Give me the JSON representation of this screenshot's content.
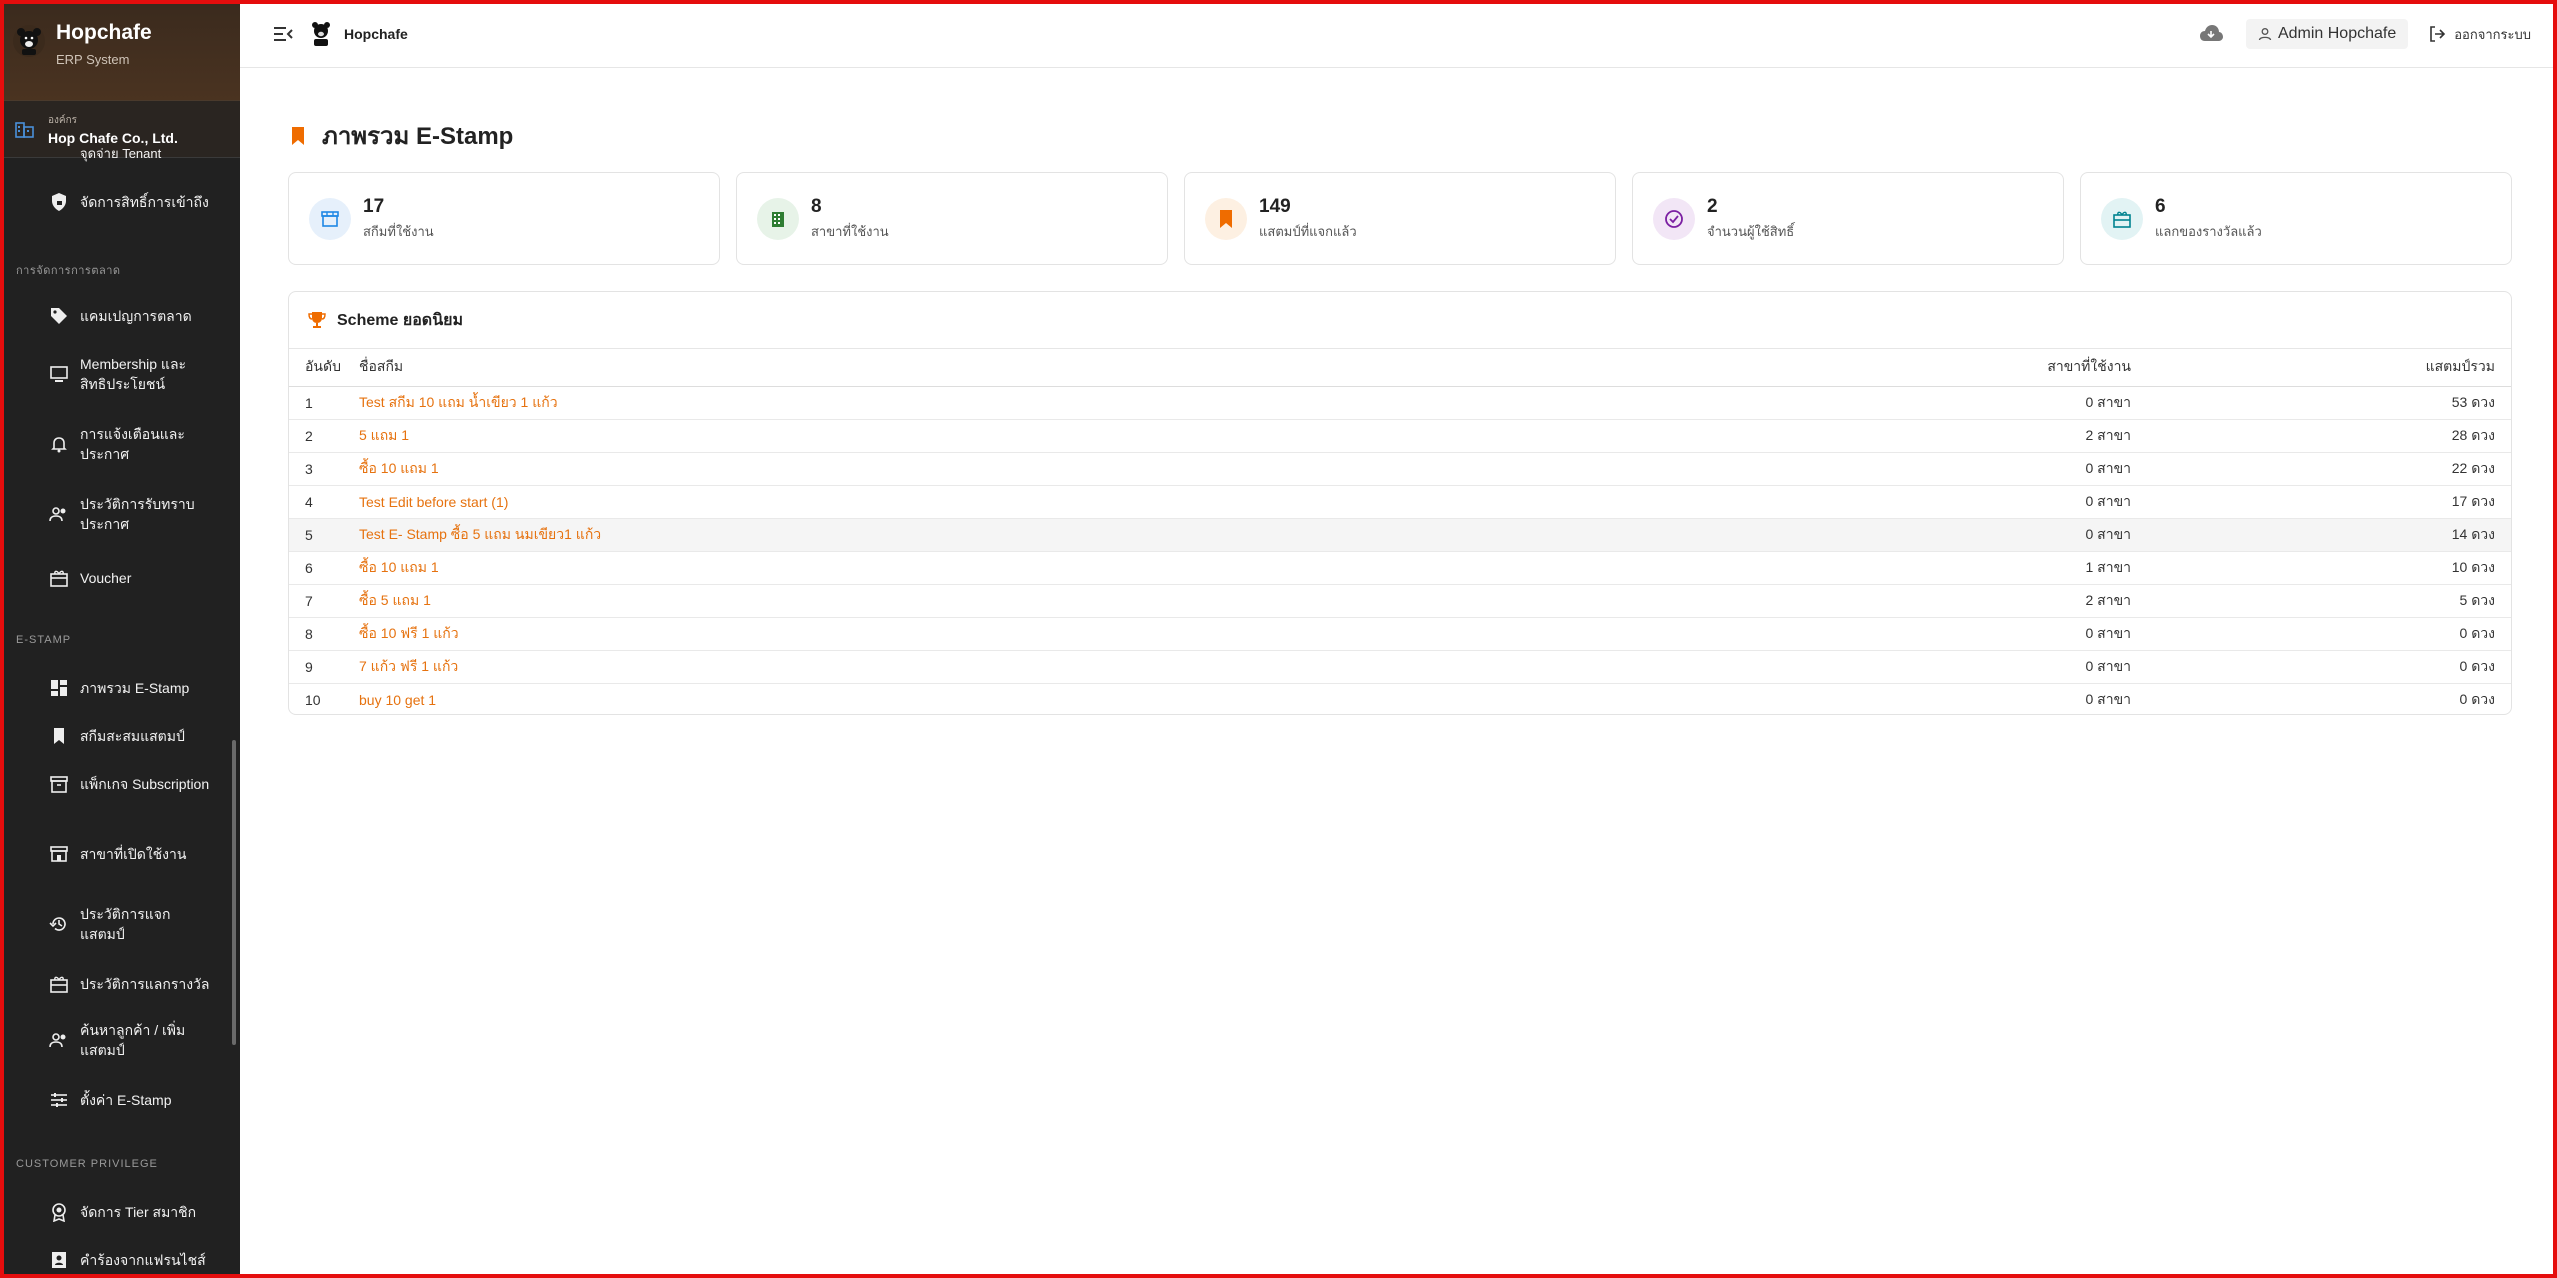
{
  "sidebar": {
    "brand_name": "Hopchafe",
    "brand_sub": "ERP System",
    "org_label": "องค์กร",
    "org_name": "Hop Chafe Co., Ltd.",
    "partial_item": "จุดจ่าย Tenant",
    "item_access": "จัดการสิทธิ์การเข้าถึง",
    "section_marketing": "การจัดการการตลาด",
    "item_campaign": "แคมเปญการตลาด",
    "item_membership": "Membership และสิทธิประโยชน์",
    "item_notification": "การแจ้งเตือนและประกาศ",
    "item_ack_history": "ประวัติการรับทราบประกาศ",
    "item_voucher": "Voucher",
    "section_estamp": "E-STAMP",
    "item_overview": "ภาพรวม E-Stamp",
    "item_stamp_scheme": "สกีมสะสมแสตมป์",
    "item_package": "แพ็กเกจ Subscription",
    "item_branches": "สาขาที่เปิดใช้งาน",
    "item_issue_history": "ประวัติการแจกแสตมป์",
    "item_redeem_history": "ประวัติการแลกรางวัล",
    "item_search_customer": "ค้นหาลูกค้า / เพิ่มแสตมป์",
    "item_settings": "ตั้งค่า E-Stamp",
    "section_privilege": "CUSTOMER PRIVILEGE",
    "item_tier": "จัดการ Tier สมาชิก",
    "item_franchise": "คำร้องจากแฟรนไชส์"
  },
  "topbar": {
    "title": "Hopchafe",
    "user": "Admin Hopchafe",
    "logout": "ออกจากระบบ"
  },
  "page": {
    "title": "ภาพรวม E-Stamp"
  },
  "stats": [
    {
      "value": "17",
      "label": "สกีมที่ใช้งาน",
      "color": "#1e88e5",
      "bg": "#e6f0fb"
    },
    {
      "value": "8",
      "label": "สาขาที่ใช้งาน",
      "color": "#2e7d32",
      "bg": "#e7f3e8"
    },
    {
      "value": "149",
      "label": "แสตมป์ที่แจกแล้ว",
      "color": "#ef6c00",
      "bg": "#fdf0e2"
    },
    {
      "value": "2",
      "label": "จำนวนผู้ใช้สิทธิ์",
      "color": "#7b1fa2",
      "bg": "#f2e6f6"
    },
    {
      "value": "6",
      "label": "แลกของรางวัลแล้ว",
      "color": "#00838f",
      "bg": "#e2f3f4"
    }
  ],
  "scheme_panel": {
    "title": "Scheme ยอดนิยม",
    "columns": [
      "อันดับ",
      "ชื่อสกีม",
      "สาขาที่ใช้งาน",
      "แสตมป์รวม"
    ],
    "rows": [
      {
        "rank": "1",
        "name": "Test สกีม 10 แถม น้ำเขียว 1 แก้ว",
        "branches": "0 สาขา",
        "total": "53 ดวง"
      },
      {
        "rank": "2",
        "name": "5 แถม 1",
        "branches": "2 สาขา",
        "total": "28 ดวง"
      },
      {
        "rank": "3",
        "name": "ซื้อ 10 แถม 1",
        "branches": "0 สาขา",
        "total": "22 ดวง"
      },
      {
        "rank": "4",
        "name": "Test Edit before start (1)",
        "branches": "0 สาขา",
        "total": "17 ดวง"
      },
      {
        "rank": "5",
        "name": "Test E- Stamp ซื้อ 5 แถม นมเขียว1 แก้ว",
        "branches": "0 สาขา",
        "total": "14 ดวง"
      },
      {
        "rank": "6",
        "name": "ซื้อ 10 แถม 1",
        "branches": "1 สาขา",
        "total": "10 ดวง"
      },
      {
        "rank": "7",
        "name": "ซื้อ 5 แถม 1",
        "branches": "2 สาขา",
        "total": "5 ดวง"
      },
      {
        "rank": "8",
        "name": "ซื้อ 10 ฟรี 1 แก้ว",
        "branches": "0 สาขา",
        "total": "0 ดวง"
      },
      {
        "rank": "9",
        "name": "7 แก้ว ฟรี 1 แก้ว",
        "branches": "0 สาขา",
        "total": "0 ดวง"
      },
      {
        "rank": "10",
        "name": "buy 10 get 1",
        "branches": "0 สาขา",
        "total": "0 ดวง"
      }
    ]
  }
}
